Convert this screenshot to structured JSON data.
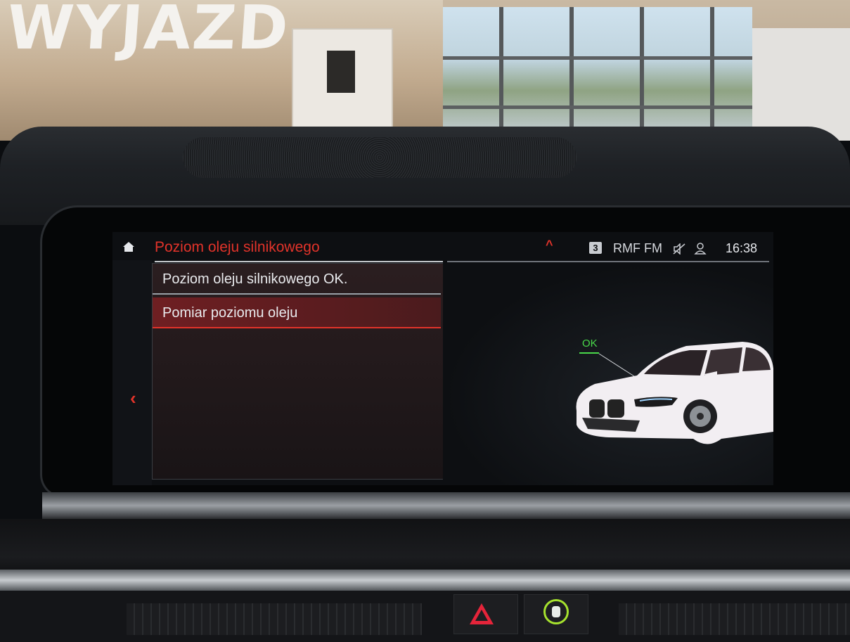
{
  "screen": {
    "title": "Poziom oleju silnikowego",
    "status_bar": {
      "preset_number": "3",
      "station": "RMF FM",
      "time": "16:38"
    },
    "menu_items": [
      {
        "label": "Poziom oleju silnikowego OK."
      },
      {
        "label": "Pomiar poziomu oleju"
      }
    ],
    "status_overlay": {
      "label": "OK"
    },
    "colors": {
      "accent": "#e2332a",
      "ok_green": "#49d84a",
      "selected_row": "#6f1f22"
    },
    "icons": [
      "home-icon",
      "back-chevron-icon",
      "up-caret-icon",
      "mute-icon",
      "user-profile-icon",
      "car-icon"
    ]
  },
  "background_text": {
    "sign": "WYJAZD"
  }
}
